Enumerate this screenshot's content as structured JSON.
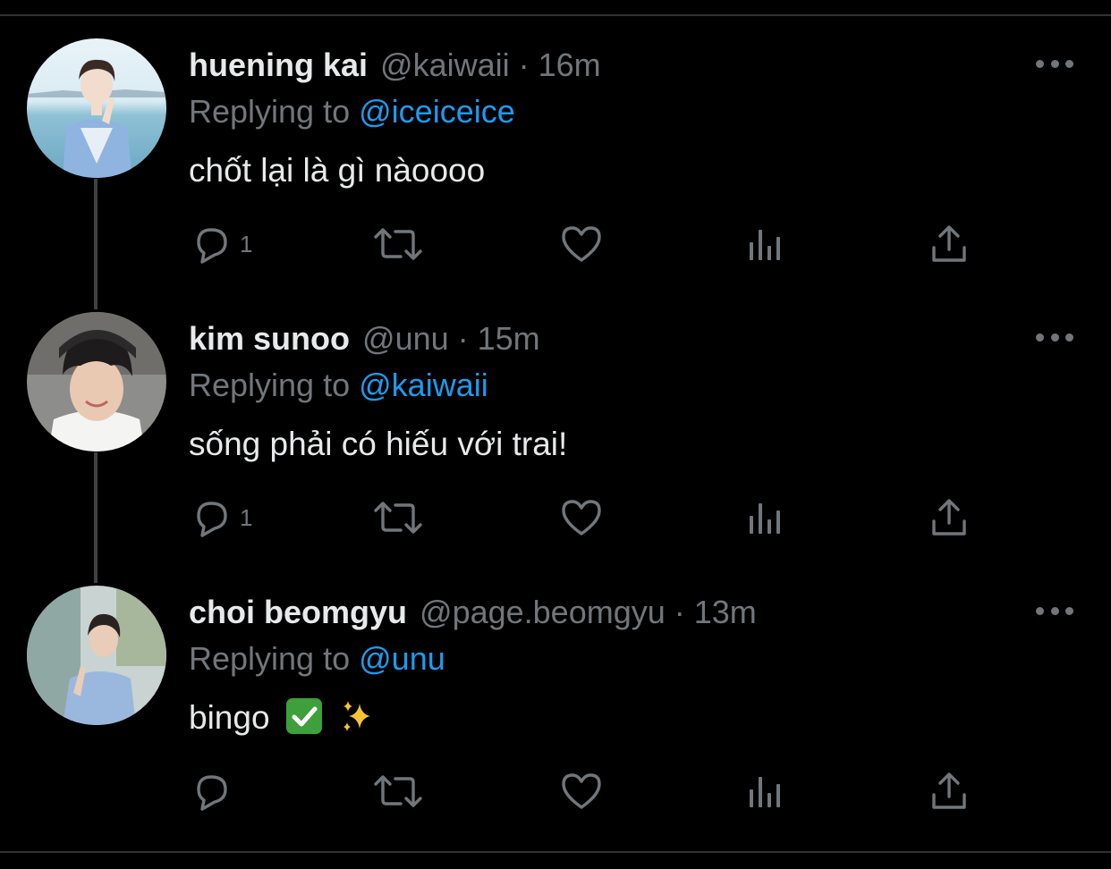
{
  "tweets": [
    {
      "name": "huening kai",
      "handle": "@kaiwaii",
      "separator": "·",
      "time": "16m",
      "replying_prefix": "Replying to",
      "replying_to": "@iceiceice",
      "text": "chốt lại là gì nàoooo",
      "reply_count": "1",
      "avatar_icon": "avatar-photo-huening-kai"
    },
    {
      "name": "kim sunoo",
      "handle": "@unu",
      "separator": "·",
      "time": "15m",
      "replying_prefix": "Replying to",
      "replying_to": "@kaiwaii",
      "text": "sống phải có hiếu với trai!",
      "reply_count": "1",
      "avatar_icon": "avatar-photo-kim-sunoo"
    },
    {
      "name": "choi beomgyu",
      "handle": "@page.beomgyu",
      "separator": "·",
      "time": "13m",
      "replying_prefix": "Replying to",
      "replying_to": "@unu",
      "text": "bingo",
      "emojis": [
        "check-mark-button-emoji",
        "sparkles-emoji"
      ],
      "reply_count": "",
      "avatar_icon": "avatar-photo-choi-beomgyu"
    }
  ],
  "icons": {
    "more": "more-horizontal-icon",
    "reply": "reply-bubble-icon",
    "retweet": "retweet-icon",
    "like": "heart-icon",
    "views": "views-bar-chart-icon",
    "share": "share-upload-icon"
  },
  "colors": {
    "background": "#000000",
    "primary_text": "#e7e9ea",
    "secondary_text": "#71767b",
    "link": "#1d9bf0",
    "divider": "#2f3336"
  }
}
